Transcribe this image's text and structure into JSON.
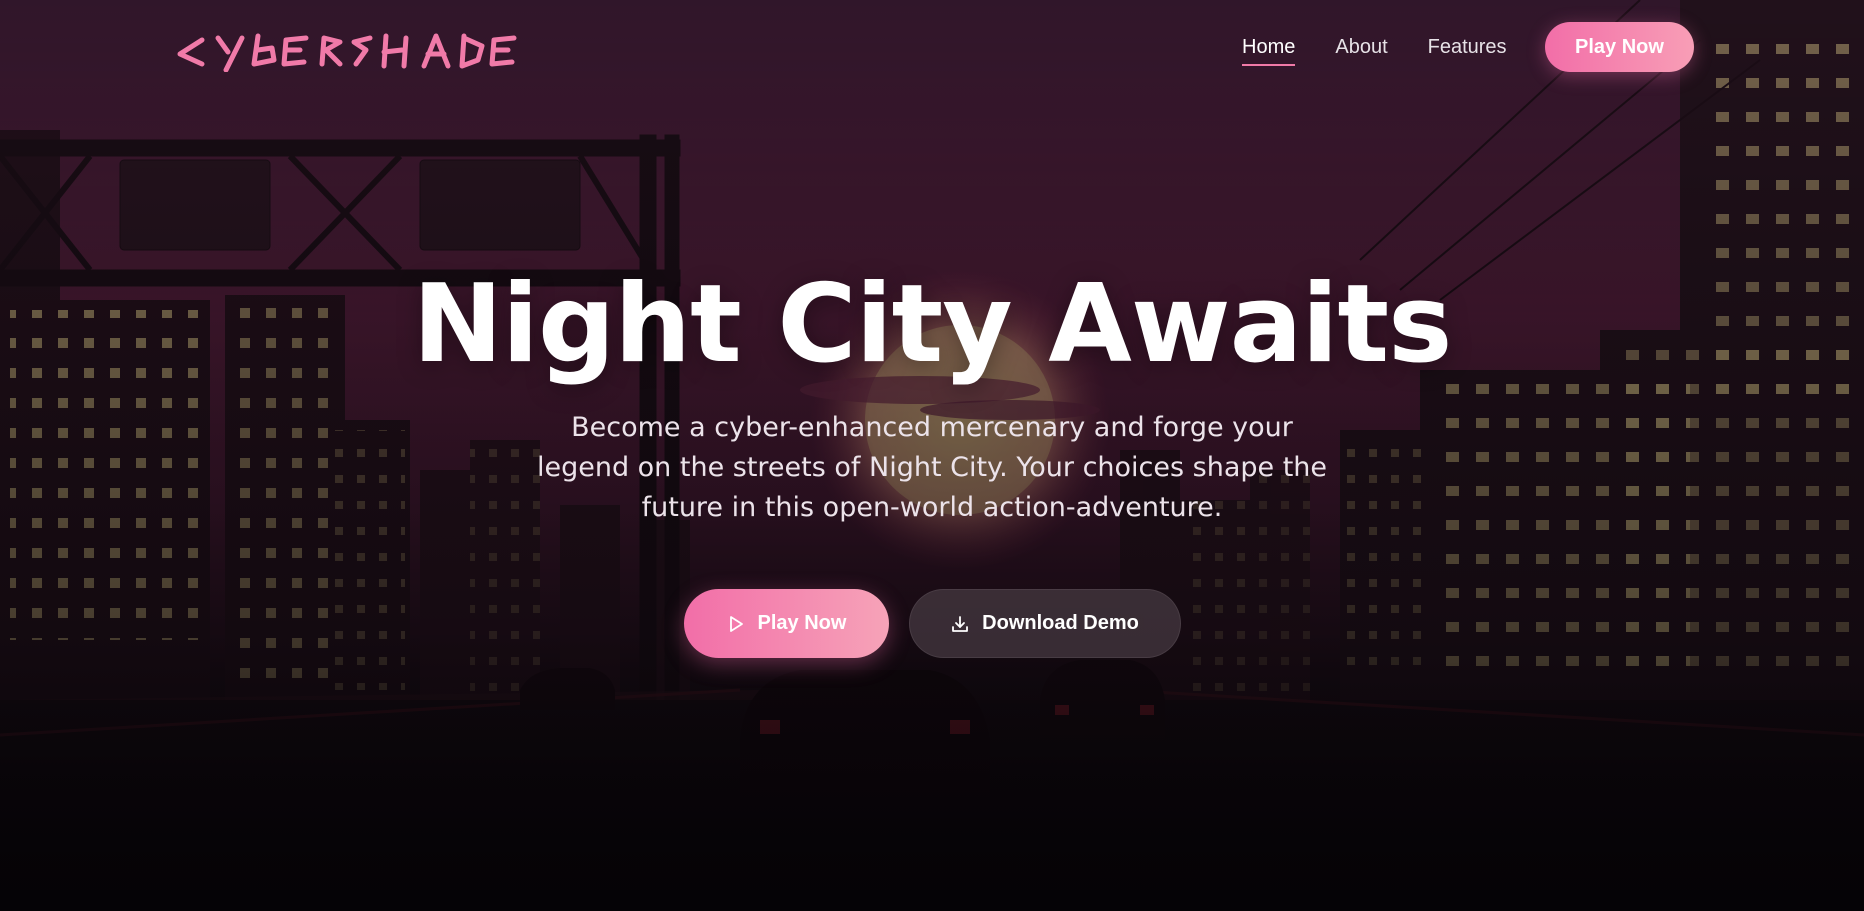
{
  "brand": {
    "logo_text": "CYBERSHADE"
  },
  "nav": {
    "links": [
      {
        "label": "Home",
        "active": true
      },
      {
        "label": "About",
        "active": false
      },
      {
        "label": "Features",
        "active": false
      }
    ],
    "cta_label": "Play Now"
  },
  "hero": {
    "title": "Night City Awaits",
    "subtitle": "Become a cyber-enhanced mercenary and forge your legend on the streets of Night City. Your choices shape the future in this open-world action-adventure.",
    "primary_button": {
      "label": "Play Now",
      "icon": "play-icon"
    },
    "secondary_button": {
      "label": "Download Demo",
      "icon": "download-icon"
    }
  },
  "colors": {
    "accent_pink": "#f26ea8",
    "accent_pink_light": "#f89eb6",
    "sky_top": "#3b1c33",
    "sky_mid": "#6b2442",
    "night_bottom": "#0b070b"
  }
}
